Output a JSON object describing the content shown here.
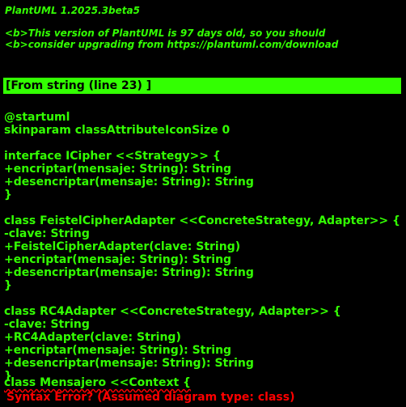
{
  "header": {
    "version_line": "PlantUML 1.2025.3beta5",
    "warning_line_1": "<b>This version of PlantUML is 97 days old, so you should",
    "warning_line_2": "<b>consider upgrading from https://plantuml.com/download"
  },
  "banner": {
    "text": "[From string (line 23) ]"
  },
  "source_lines": [
    "@startuml",
    "skinparam classAttributeIconSize 0",
    "",
    "interface ICipher <<Strategy>> {",
    "+encriptar(mensaje: String): String",
    "+desencriptar(mensaje: String): String",
    "}",
    "",
    "class FeistelCipherAdapter <<ConcreteStrategy, Adapter>> {",
    "-clave: String",
    "+FeistelCipherAdapter(clave: String)",
    "+encriptar(mensaje: String): String",
    "+desencriptar(mensaje: String): String",
    "}",
    "",
    "class RC4Adapter <<ConcreteStrategy, Adapter>> {",
    "-clave: String",
    "+RC4Adapter(clave: String)",
    "+encriptar(mensaje: String): String",
    "+desencriptar(mensaje: String): String",
    "}",
    "",
    "class Mensajero <<Context {"
  ],
  "error": {
    "message": "Syntax Error? (Assumed diagram type: class)"
  },
  "colors": {
    "background": "#000000",
    "text": "#33FF02",
    "error": "#FF0000"
  }
}
